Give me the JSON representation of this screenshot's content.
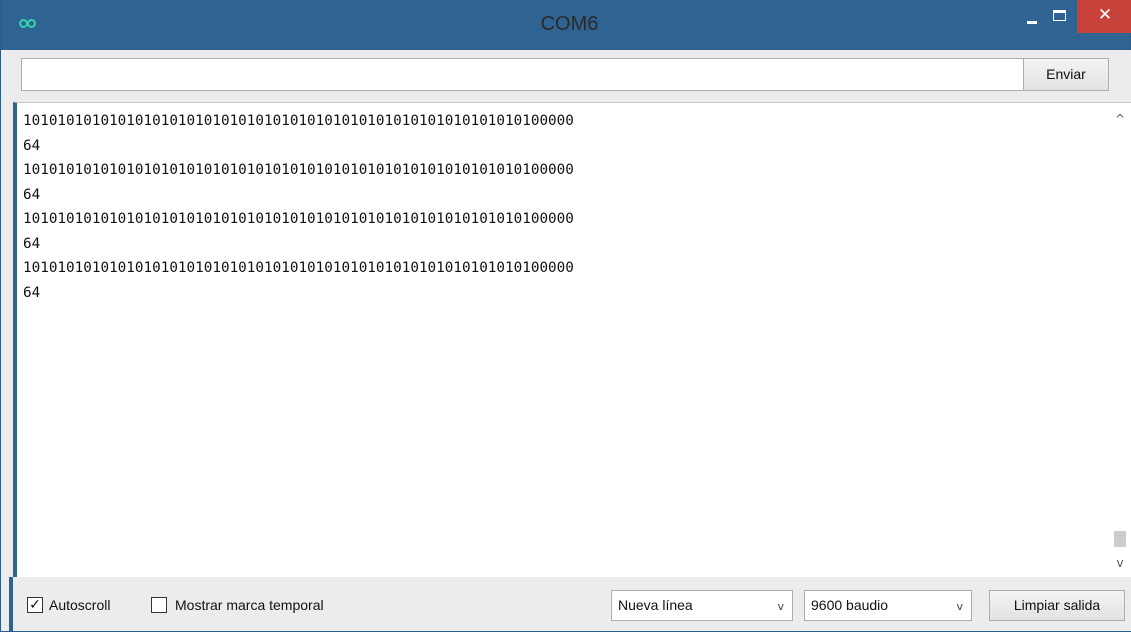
{
  "window": {
    "title": "COM6",
    "close_glyph": "✕"
  },
  "send": {
    "input_value": "",
    "input_placeholder": "",
    "button_label": "Enviar"
  },
  "output": {
    "lines": [
      "1010101010101010101010101010101010101010101010101010101010100000",
      "64",
      "1010101010101010101010101010101010101010101010101010101010100000",
      "64",
      "1010101010101010101010101010101010101010101010101010101010100000",
      "64",
      "1010101010101010101010101010101010101010101010101010101010100000",
      "64"
    ],
    "scroll_up_glyph": "^",
    "scroll_down_glyph": "v"
  },
  "statusbar": {
    "autoscroll": {
      "label": "Autoscroll",
      "checked": true,
      "mark": "✓"
    },
    "timestamp": {
      "label": "Mostrar marca temporal",
      "checked": false,
      "mark": ""
    },
    "line_ending": {
      "value": "Nueva línea",
      "caret": "v"
    },
    "baud_rate": {
      "value": "9600 baudio",
      "caret": "v"
    },
    "clear_label": "Limpiar salida"
  },
  "colors": {
    "titlebar": "#2f6392",
    "close_button": "#c7433a",
    "background": "#ececec"
  }
}
